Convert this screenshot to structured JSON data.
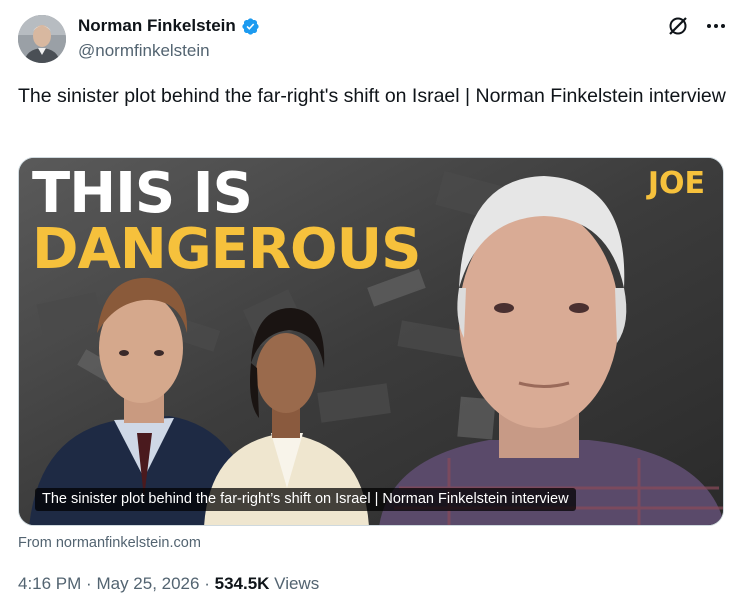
{
  "author": {
    "display_name": "Norman Finkelstein",
    "handle": "@normfinkelstein",
    "verified": true,
    "verified_color": "#1d9bf0"
  },
  "tweet": {
    "text": "The sinister plot behind the far-right's shift on Israel | Norman Finkelstein interview"
  },
  "media": {
    "headline_line1": "THIS IS",
    "headline_line2": "DANGEROUS",
    "headline_accent_color": "#f6c13c",
    "brand": "JOE",
    "caption": "The sinister plot behind the far-right’s shift on Israel | Norman Finkelstein interview"
  },
  "source": {
    "text": "From normanfinkelstein.com"
  },
  "meta": {
    "time": "4:16 PM",
    "separator": "·",
    "date": "May 25, 2026",
    "views_count": "534.5K",
    "views_label": "Views"
  },
  "icons": {
    "grok": "grok-slash-icon",
    "more": "more-horizontal-icon",
    "verified": "verified-badge-icon"
  }
}
